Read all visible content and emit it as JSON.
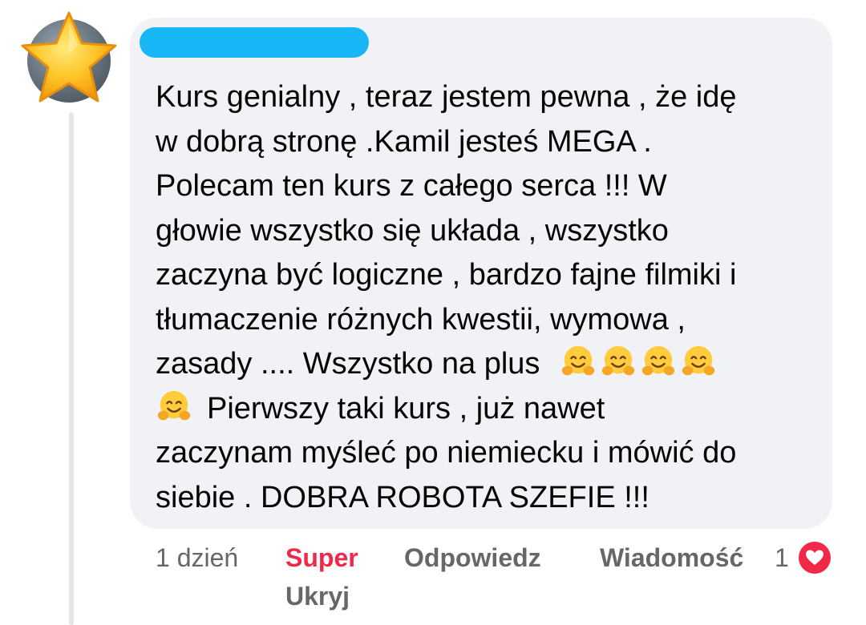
{
  "comment": {
    "author_name": "",
    "text_lines": [
      "Kurs genialny , teraz jestem pewna , że idę",
      "w dobrą stronę .Kamil jesteś MEGA .",
      "Polecam ten kurs z całego serca !!! W",
      "głowie wszystko się układa , wszystko",
      "zaczyna być logiczne , bardzo fajne filmiki i",
      "tłumaczenie różnych kwestii, wymowa ,",
      "zasady .... Wszystko na plus",
      "Pierwszy taki kurs , już nawet",
      "zaczynam myśleć po niemiecku i mówić do",
      "siebie . DOBRA ROBOTA SZEFIE !!!"
    ],
    "emoji_name": "hugging-face"
  },
  "actions": {
    "timestamp": "1 dzień",
    "super_label": "Super",
    "reply_label": "Odpowiedz",
    "message_label": "Wiadomość",
    "hide_label": "Ukryj",
    "reaction_count": "1",
    "reaction_icon": "heart-icon"
  },
  "colors": {
    "bubble_bg": "#f0f2f5",
    "super_red": "#f02849",
    "secondary_text": "#65676b",
    "name_redaction": "#18b6f7"
  }
}
